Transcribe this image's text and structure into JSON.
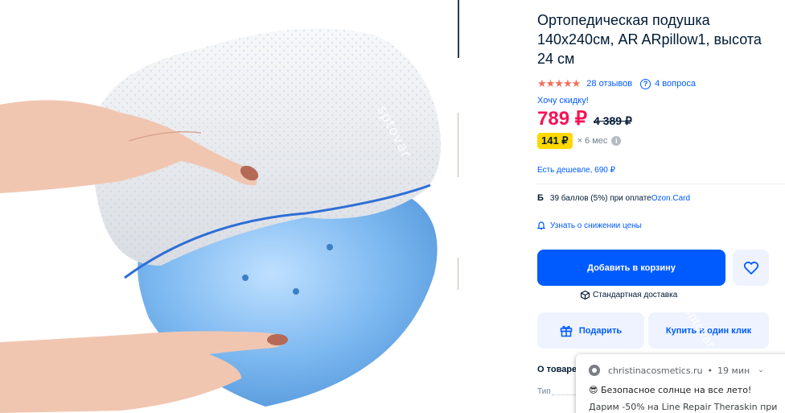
{
  "product": {
    "title": "Ортопедическая подушка 140x240см, AR ARpillow1, высота 24 см",
    "photo_alt": "pillow-photo",
    "watermark": "sptovar"
  },
  "rating": {
    "stars": "★★★★★",
    "reviews": "28 отзывов",
    "questions": "4 вопроса"
  },
  "discount_link": "Хочу скидку!",
  "price": {
    "current": "789 ₽",
    "old": "4 389 ₽"
  },
  "installment": {
    "amount": "141 ₽",
    "term": "× 6 мес"
  },
  "cheaper": "Есть дешевле, 690 ₽",
  "points": {
    "icon": "Б",
    "text": "39 баллов (5%) при оплате ",
    "card": "Ozon.Card"
  },
  "notify_price": "Узнать о снижении цены",
  "buttons": {
    "cart": "Добавить в корзину",
    "gift": "Подарить",
    "one_click": "Купить в один клик"
  },
  "delivery": "Стандартная доставка",
  "about": {
    "heading": "О товаре",
    "type_label": "Тип"
  },
  "notification": {
    "site": "christinacosmetics.ru",
    "time": "19 мин",
    "title": "😎 Безопасное солнце на все лето!",
    "body": "Дарим -50% на Line Repair Theraskin при"
  },
  "colors": {
    "accent": "#005bff",
    "price": "#f91155",
    "stars": "#f26e5a",
    "installment_badge": "#ffd800"
  }
}
